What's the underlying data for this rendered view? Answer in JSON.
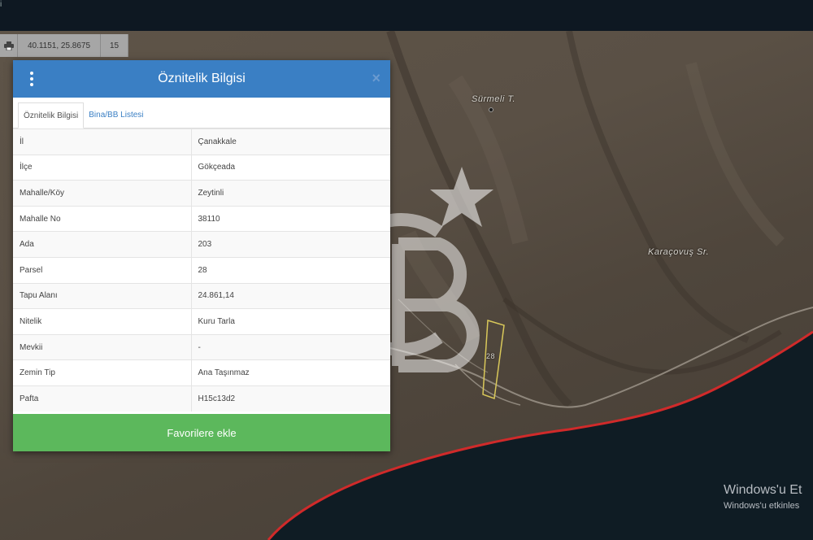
{
  "topbar": {
    "edge_glyph": "i"
  },
  "coordbar": {
    "print_icon": "printer-icon",
    "coords": "40.1151, 25.8675",
    "zoom": "15"
  },
  "map": {
    "labels": {
      "hill": "Sürmeli T.",
      "stream": "Karaçovuş Sr.",
      "parcel": "28"
    },
    "colors": {
      "land": "#564c41",
      "sea": "#0f1c24",
      "coastline": "#d02a2a",
      "parcel": "#d9c85a"
    }
  },
  "panel": {
    "title": "Öznitelik Bilgisi",
    "menu_icon": "kebab-menu-icon",
    "close_icon": "close-icon",
    "close_symbol": "×",
    "tabs": [
      {
        "label": "Öznitelik Bilgisi",
        "active": true
      },
      {
        "label": "Bina/BB Listesi",
        "active": false
      }
    ],
    "rows": [
      {
        "key": "İl",
        "value": "Çanakkale"
      },
      {
        "key": "İlçe",
        "value": "Gökçeada"
      },
      {
        "key": "Mahalle/Köy",
        "value": "Zeytinli"
      },
      {
        "key": "Mahalle No",
        "value": "38110"
      },
      {
        "key": "Ada",
        "value": "203"
      },
      {
        "key": "Parsel",
        "value": "28"
      },
      {
        "key": "Tapu Alanı",
        "value": "24.861,14"
      },
      {
        "key": "Nitelik",
        "value": "Kuru Tarla"
      },
      {
        "key": "Mevkii",
        "value": "-"
      },
      {
        "key": "Zemin Tip",
        "value": "Ana Taşınmaz"
      },
      {
        "key": "Pafta",
        "value": "H15c13d2"
      }
    ],
    "favorite_button": "Favorilere ekle",
    "colors": {
      "header": "#3a7fc4",
      "button": "#5cb85c"
    }
  },
  "watermark": {
    "logo": "cb-star-logo"
  },
  "windows_activation": {
    "line1": "Windows'u Et",
    "line2": "Windows'u etkinles"
  }
}
